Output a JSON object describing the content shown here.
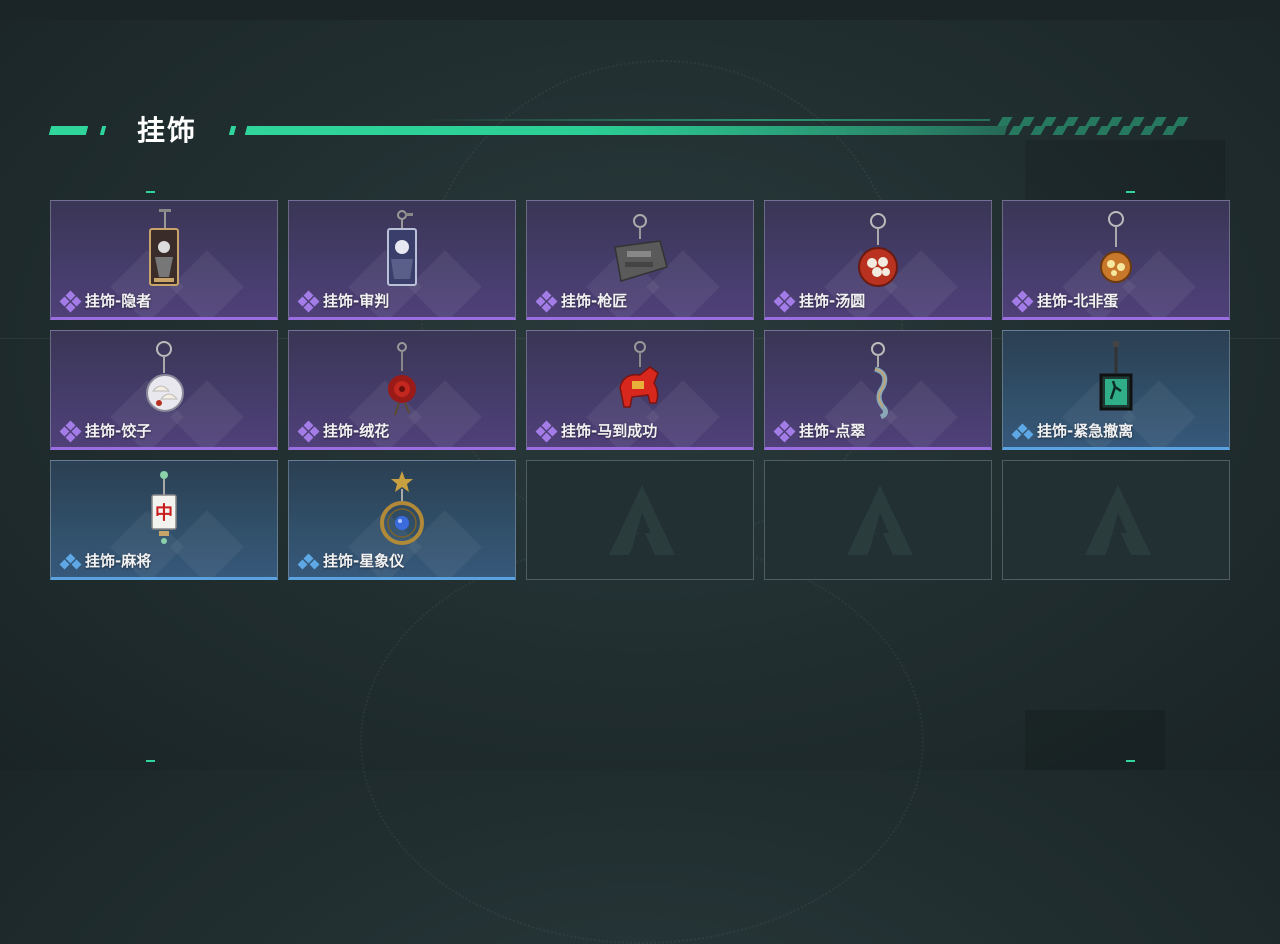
{
  "header": {
    "title": "挂饰"
  },
  "items": [
    {
      "label": "挂饰-隐者",
      "rarity": "purple",
      "icon": "hermit-tarot-card-icon"
    },
    {
      "label": "挂饰-审判",
      "rarity": "purple",
      "icon": "judgement-tarot-card-icon"
    },
    {
      "label": "挂饰-枪匠",
      "rarity": "purple",
      "icon": "gunsmith-crate-icon"
    },
    {
      "label": "挂饰-汤圆",
      "rarity": "purple",
      "icon": "tangyuan-bowl-icon"
    },
    {
      "label": "挂饰-北非蛋",
      "rarity": "purple",
      "icon": "shakshuka-pan-icon"
    },
    {
      "label": "挂饰-饺子",
      "rarity": "purple",
      "icon": "dumpling-plate-icon"
    },
    {
      "label": "挂饰-绒花",
      "rarity": "purple",
      "icon": "velvet-flower-icon"
    },
    {
      "label": "挂饰-马到成功",
      "rarity": "purple",
      "icon": "red-horse-icon"
    },
    {
      "label": "挂饰-点翠",
      "rarity": "purple",
      "icon": "kingfisher-ornament-icon"
    },
    {
      "label": "挂饰-紧急撤离",
      "rarity": "blue",
      "icon": "emergency-exit-sign-icon"
    },
    {
      "label": "挂饰-麻将",
      "rarity": "blue",
      "icon": "mahjong-tile-icon"
    },
    {
      "label": "挂饰-星象仪",
      "rarity": "blue",
      "icon": "astrolabe-icon"
    },
    {
      "label": "",
      "rarity": "empty",
      "icon": "empty-slot-logo-icon"
    },
    {
      "label": "",
      "rarity": "empty",
      "icon": "empty-slot-logo-icon"
    },
    {
      "label": "",
      "rarity": "empty",
      "icon": "empty-slot-logo-icon"
    }
  ],
  "colors": {
    "accent": "#2fd59a",
    "purple_rarity": "#9a6ee0",
    "blue_rarity": "#5aa2e0"
  }
}
